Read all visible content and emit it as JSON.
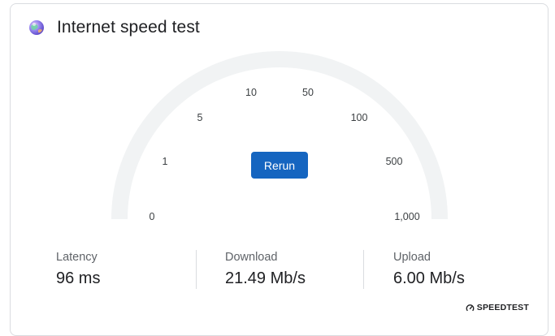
{
  "header": {
    "logo_icon": "speedtest-globe-icon",
    "title": "Internet speed test"
  },
  "gauge": {
    "track_color": "#f1f3f4",
    "ticks": [
      "0",
      "1",
      "5",
      "10",
      "50",
      "100",
      "500",
      "1,000"
    ],
    "rerun_label": "Rerun",
    "accent_color": "#1565c0"
  },
  "stats": {
    "latency": {
      "label": "Latency",
      "value": "96 ms"
    },
    "download": {
      "label": "Download",
      "value": "21.49 Mb/s"
    },
    "upload": {
      "label": "Upload",
      "value": "6.00 Mb/s"
    }
  },
  "brand": {
    "icon": "speedometer-icon",
    "label": "SPEEDTEST"
  }
}
